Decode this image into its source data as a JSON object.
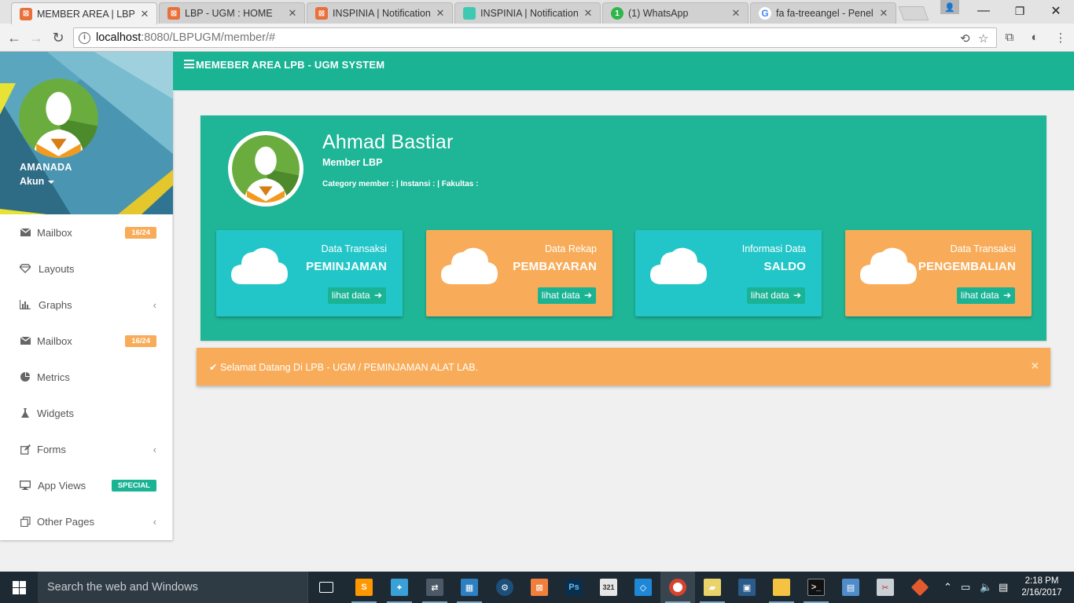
{
  "browser": {
    "tabs": [
      {
        "title": "MEMBER AREA | LBPUGM",
        "active": true
      },
      {
        "title": "LBP - UGM : HOME",
        "active": false
      },
      {
        "title": "INSPINIA | Notifications",
        "active": false
      },
      {
        "title": "INSPINIA | Notifications",
        "active": false
      },
      {
        "title": "(1) WhatsApp",
        "active": false
      },
      {
        "title": "fa fa-treeangel - Penelu",
        "active": false
      }
    ],
    "url_host": "localhost",
    "url_rest": ":8080/LBPUGM/member/#"
  },
  "sidebar": {
    "user_name": "AMANADA",
    "account_label": "Akun",
    "items": [
      {
        "label": "Mailbox",
        "icon": "envelope-icon",
        "badge": "16/24",
        "badge_color": "#f8ac59"
      },
      {
        "label": "Layouts",
        "icon": "diamond-icon"
      },
      {
        "label": "Graphs",
        "icon": "bar-chart-icon",
        "chevron": true
      },
      {
        "label": "Mailbox",
        "icon": "envelope-icon",
        "badge": "16/24",
        "badge_color": "#f8ac59"
      },
      {
        "label": "Metrics",
        "icon": "pie-chart-icon"
      },
      {
        "label": "Widgets",
        "icon": "flask-icon"
      },
      {
        "label": "Forms",
        "icon": "edit-icon",
        "chevron": true
      },
      {
        "label": "App Views",
        "icon": "desktop-icon",
        "badge": "SPECIAL",
        "badge_color": "#1ab394"
      },
      {
        "label": "Other Pages",
        "icon": "files-icon",
        "chevron": true
      }
    ]
  },
  "header": {
    "title": "MEMEBER AREA LPB - UGM SYSTEM"
  },
  "profile": {
    "name": "Ahmad Bastiar",
    "role": "Member LBP",
    "category_line": "Category member : | Instansi : | Fakultas :"
  },
  "cards": [
    {
      "subtitle": "Data Transaksi",
      "title": "PEMINJAMAN",
      "button": "lihat data",
      "color": "#23c6c8"
    },
    {
      "subtitle": "Data Rekap",
      "title": "PEMBAYARAN",
      "button": "lihat data",
      "color": "#f8ac59"
    },
    {
      "subtitle": "Informasi Data",
      "title": "SALDO",
      "button": "lihat data",
      "color": "#23c6c8"
    },
    {
      "subtitle": "Data Transaksi",
      "title": "PENGEMBALIAN",
      "button": "lihat data",
      "color": "#f8ac59"
    }
  ],
  "alert": {
    "message": "Selamat Datang Di LPB - UGM / PEMINJAMAN ALAT LAB.",
    "close": "×"
  },
  "taskbar": {
    "search_placeholder": "Search the web and Windows",
    "time": "2:18 PM",
    "date": "2/16/2017"
  },
  "colors": {
    "primary": "#1ab394",
    "orange": "#f8ac59",
    "teal": "#23c6c8"
  }
}
